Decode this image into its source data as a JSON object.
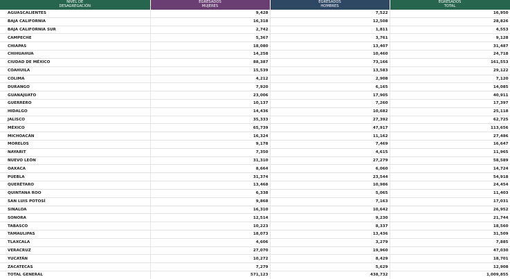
{
  "header": {
    "col0": [
      "NIVEL DE",
      "DESAGREGACIÓN"
    ],
    "col1": [
      "EGRESADOS",
      "MUJERES"
    ],
    "col2": [
      "EGRESADOS",
      "HOMBRES"
    ],
    "col3": [
      "EGRESADOS",
      "TOTAL"
    ]
  },
  "rows": [
    {
      "name": "AGUASCALIENTES",
      "mujeres": "9,428",
      "hombres": "7,522",
      "total": "16,950"
    },
    {
      "name": "BAJA CALIFORNIA",
      "mujeres": "16,318",
      "hombres": "12,508",
      "total": "28,826"
    },
    {
      "name": "BAJA CALIFORNIA SUR",
      "mujeres": "2,742",
      "hombres": "1,811",
      "total": "4,553"
    },
    {
      "name": "CAMPECHE",
      "mujeres": "5,367",
      "hombres": "3,761",
      "total": "9,128"
    },
    {
      "name": "CHIAPAS",
      "mujeres": "18,080",
      "hombres": "13,407",
      "total": "31,487"
    },
    {
      "name": "CHIHUAHUA",
      "mujeres": "14,258",
      "hombres": "10,460",
      "total": "24,718"
    },
    {
      "name": "CIUDAD DE MÉXICO",
      "mujeres": "88,387",
      "hombres": "73,166",
      "total": "161,553"
    },
    {
      "name": "COAHUILA",
      "mujeres": "15,539",
      "hombres": "13,583",
      "total": "29,122"
    },
    {
      "name": "COLIMA",
      "mujeres": "4,212",
      "hombres": "2,908",
      "total": "7,120"
    },
    {
      "name": "DURANGO",
      "mujeres": "7,920",
      "hombres": "6,165",
      "total": "14,085"
    },
    {
      "name": "GUANAJUATO",
      "mujeres": "23,006",
      "hombres": "17,905",
      "total": "40,911"
    },
    {
      "name": "GUERRERO",
      "mujeres": "10,137",
      "hombres": "7,260",
      "total": "17,397"
    },
    {
      "name": "HIDALGO",
      "mujeres": "14,436",
      "hombres": "10,682",
      "total": "25,118"
    },
    {
      "name": "JALISCO",
      "mujeres": "35,333",
      "hombres": "27,392",
      "total": "62,725"
    },
    {
      "name": "MÉXICO",
      "mujeres": "65,739",
      "hombres": "47,917",
      "total": "113,656"
    },
    {
      "name": "MICHOACÁN",
      "mujeres": "16,324",
      "hombres": "11,162",
      "total": "27,486"
    },
    {
      "name": "MORELOS",
      "mujeres": "9,178",
      "hombres": "7,469",
      "total": "16,647"
    },
    {
      "name": "NAYARIT",
      "mujeres": "7,350",
      "hombres": "4,615",
      "total": "11,965"
    },
    {
      "name": "NUEVO LEÓN",
      "mujeres": "31,310",
      "hombres": "27,279",
      "total": "58,589"
    },
    {
      "name": "OAXACA",
      "mujeres": "8,664",
      "hombres": "6,060",
      "total": "14,724"
    },
    {
      "name": "PUEBLA",
      "mujeres": "31,374",
      "hombres": "23,544",
      "total": "54,918"
    },
    {
      "name": "QUERÉTARO",
      "mujeres": "13,468",
      "hombres": "10,986",
      "total": "24,454"
    },
    {
      "name": "QUINTANA ROO",
      "mujeres": "6,338",
      "hombres": "5,065",
      "total": "11,403"
    },
    {
      "name": "SAN LUIS POTOSÍ",
      "mujeres": "9,868",
      "hombres": "7,163",
      "total": "17,031"
    },
    {
      "name": "SINALOA",
      "mujeres": "16,310",
      "hombres": "10,642",
      "total": "26,952"
    },
    {
      "name": "SONORA",
      "mujeres": "12,514",
      "hombres": "9,230",
      "total": "21,744"
    },
    {
      "name": "TABASCO",
      "mujeres": "10,223",
      "hombres": "8,337",
      "total": "18,560"
    },
    {
      "name": "TAMAULIPAS",
      "mujeres": "18,073",
      "hombres": "13,436",
      "total": "31,509"
    },
    {
      "name": "TLAXCALA",
      "mujeres": "4,606",
      "hombres": "3,279",
      "total": "7,885"
    },
    {
      "name": "VERACRUZ",
      "mujeres": "27,070",
      "hombres": "19,960",
      "total": "47,030"
    },
    {
      "name": "YUCATÁN",
      "mujeres": "10,272",
      "hombres": "8,429",
      "total": "18,701"
    },
    {
      "name": "ZACATECAS",
      "mujeres": "7,279",
      "hombres": "5,629",
      "total": "12,908"
    }
  ],
  "total": {
    "name": "TOTAL GENERAL",
    "mujeres": "571,123",
    "hombres": "438,732",
    "total": "1,009,855"
  },
  "colors": {
    "green": "#27654f",
    "purple": "#6b3e73",
    "navy": "#2e4763"
  }
}
